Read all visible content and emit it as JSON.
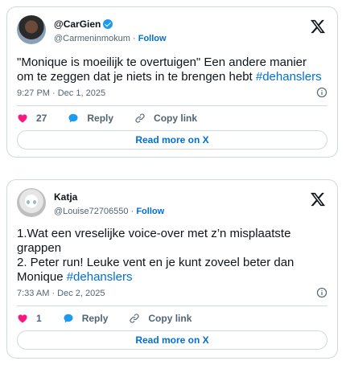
{
  "tweets": [
    {
      "display_name": "@CarGien",
      "verified": true,
      "handle": "@Carmeninmokum",
      "separator": "·",
      "follow_label": "Follow",
      "text_before": "\"Monique is moeilijk te overtuigen\" Een andere manier om te zeggen dat je niets in te brengen hebt ",
      "hashtag": "#dehanslers",
      "timestamp": "9:27 PM · Dec 1, 2025",
      "like_count": "27",
      "reply_label": "Reply",
      "copy_link_label": "Copy link",
      "read_more_label": "Read more on X"
    },
    {
      "display_name": "Katja",
      "verified": false,
      "handle": "@Louise72706550",
      "separator": "·",
      "follow_label": "Follow",
      "text_before": "1.Wat een vreselijke voice-over met z’n misplaatste grappen\n2. Peter run! Leuke vent en je kunt zoveel beter dan Monique ",
      "hashtag": "#dehanslers",
      "timestamp": "7:33 AM · Dec 2, 2025",
      "like_count": "1",
      "reply_label": "Reply",
      "copy_link_label": "Copy link",
      "read_more_label": "Read more on X"
    }
  ],
  "colors": {
    "text": "#0f1419",
    "muted": "#536471",
    "link": "#006fd6",
    "like": "#f91880",
    "reply": "#1d9bf0",
    "border": "#cfd9de"
  },
  "icons": [
    "x-logo-icon",
    "info-icon",
    "heart-icon",
    "reply-bubble-icon",
    "link-icon",
    "verified-badge-icon"
  ]
}
